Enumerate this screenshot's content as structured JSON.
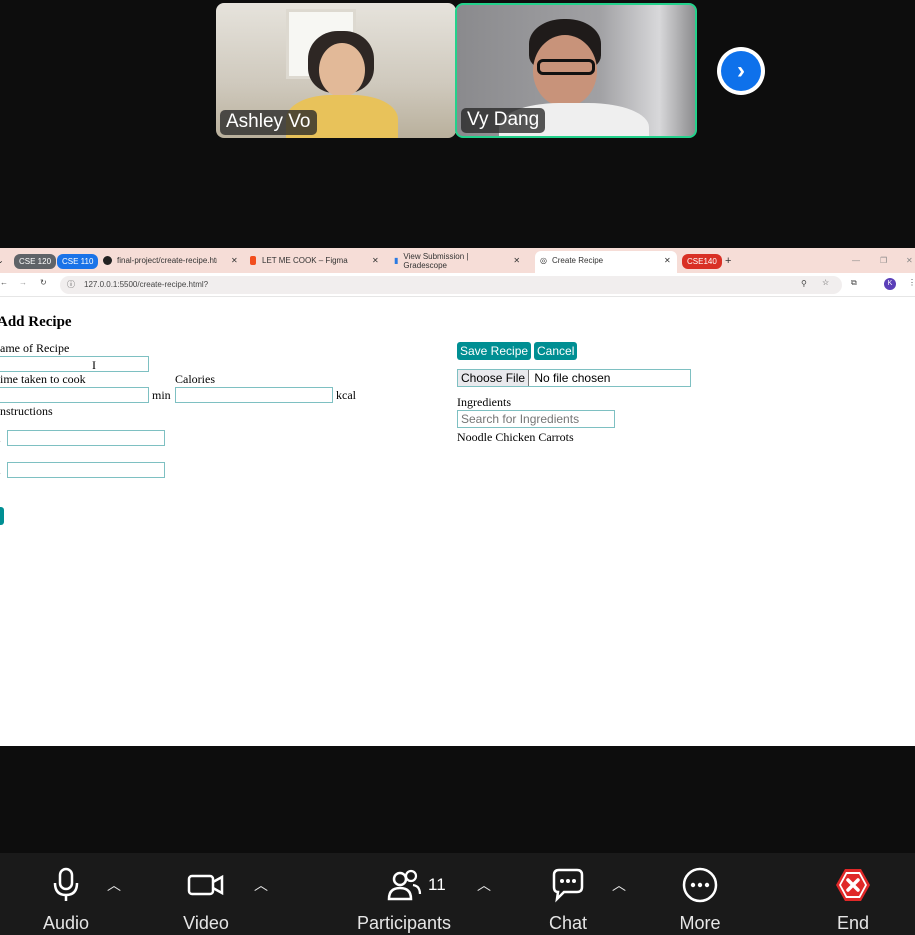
{
  "participants_strip": {
    "tiles": [
      {
        "name": "Ashley Vo"
      },
      {
        "name": "Vy Dang"
      }
    ],
    "next_icon": "chevron-right-icon"
  },
  "browser": {
    "tabs": [
      {
        "label": "CSE 120",
        "color": "#5f6368"
      },
      {
        "label": "CSE 110",
        "color": "#1a73e8"
      },
      {
        "label": "final-project/create-recipe.html"
      },
      {
        "label": "LET ME COOK – Figma"
      },
      {
        "label": "View Submission | Gradescope"
      },
      {
        "label": "Create Recipe"
      },
      {
        "label": "CSE140",
        "color": "#d93025"
      }
    ],
    "close_glyph": "✕",
    "new_tab": "+",
    "address": "127.0.0.1:5500/create-recipe.html?",
    "profile_initial": "K"
  },
  "page": {
    "title": "Add Recipe",
    "name_label": "ame of Recipe",
    "time_label": "ime taken to cook",
    "time_unit": "min",
    "calories_label": "Calories",
    "calories_unit": "kcal",
    "instructions_label": "nstructions",
    "save_button": "Save Recipe",
    "cancel_button": "Cancel",
    "choose_file": "Choose File",
    "no_file": "No file chosen",
    "ingredients_label": "Ingredients",
    "search_placeholder": "Search for Ingredients",
    "ingredients_list": "Noodle Chicken Carrots"
  },
  "toolbar": {
    "audio": "Audio",
    "video": "Video",
    "participants": "Participants",
    "participants_count": "11",
    "chat": "Chat",
    "more": "More",
    "end": "End"
  }
}
